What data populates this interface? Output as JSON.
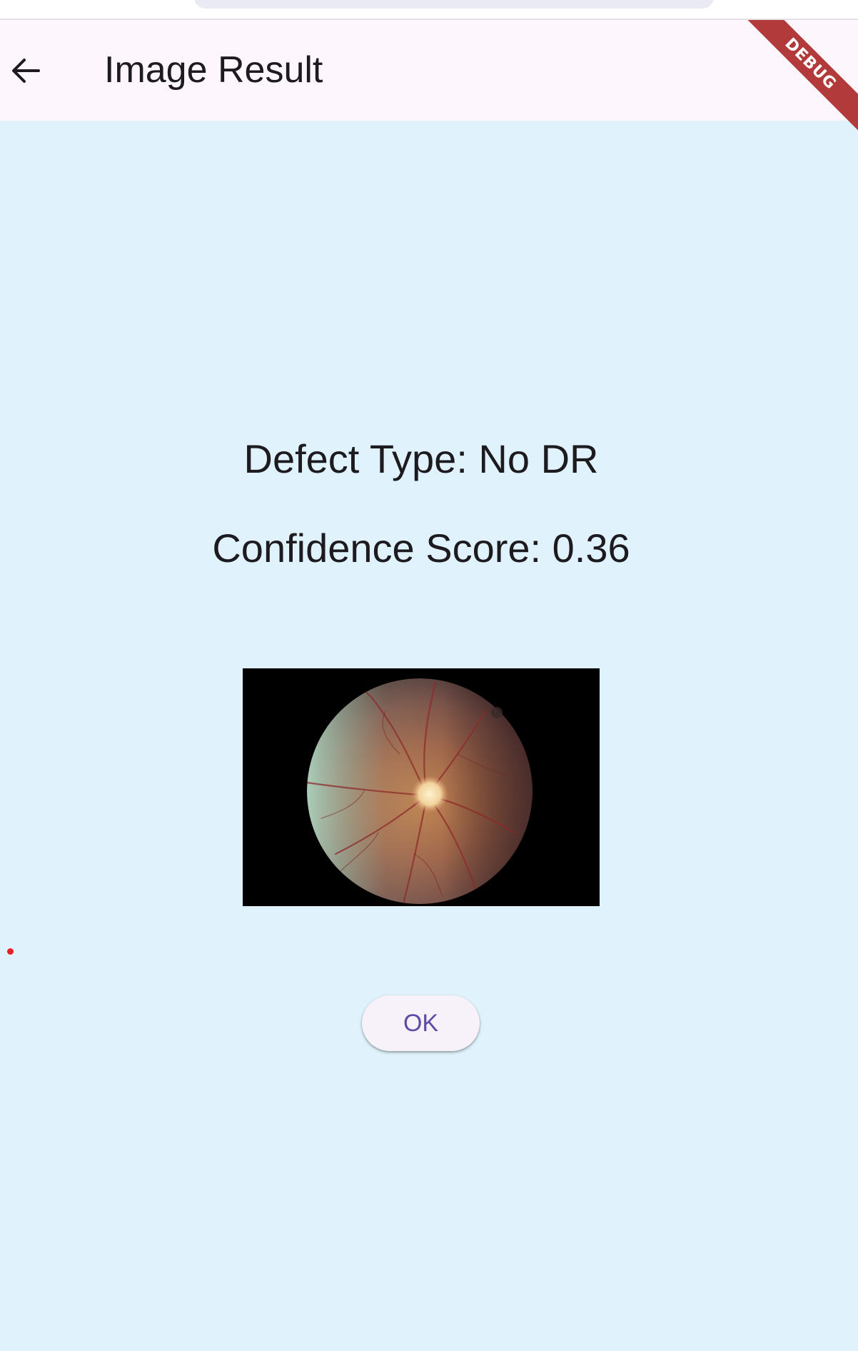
{
  "app_bar": {
    "title": "Image Result",
    "back_icon": "arrow-left-icon",
    "background": "#fdf6fc"
  },
  "debug_banner": {
    "label": "DEBUG",
    "color": "#b23a3a"
  },
  "result": {
    "defect_text": "Defect Type: No DR",
    "confidence_text": "Confidence Score: 0.36"
  },
  "image": {
    "kind": "retinal fundus photograph"
  },
  "actions": {
    "ok_label": "OK",
    "ok_text_color": "#5f4aa6"
  },
  "colors": {
    "page_background": "#e0f3fc",
    "text": "#1d1b20",
    "marker_dot": "#e52222"
  }
}
